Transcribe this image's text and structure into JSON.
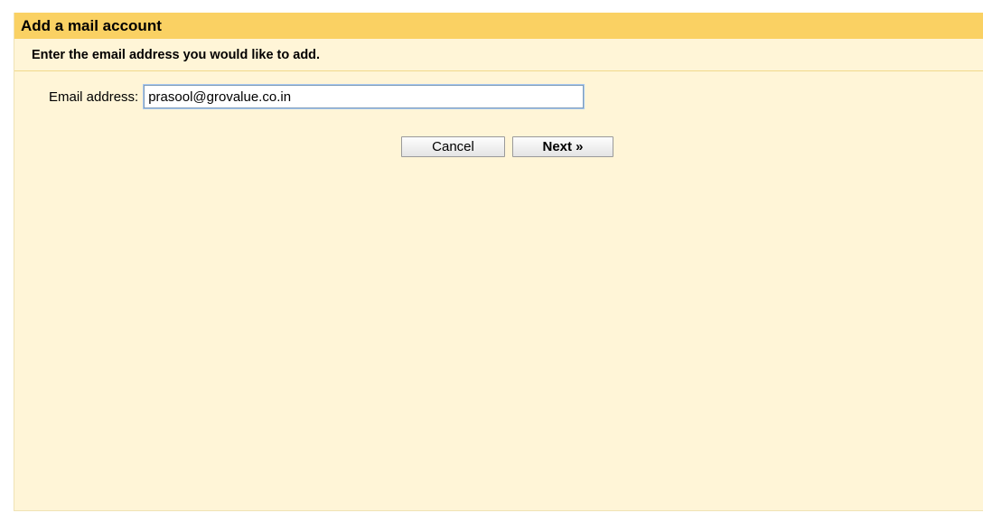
{
  "dialog": {
    "title": "Add a mail account",
    "instruction": "Enter the email address you would like to add.",
    "email_label": "Email address:",
    "email_value": "prasool@grovalue.co.in",
    "cancel_label": "Cancel",
    "next_label": "Next »"
  },
  "colors": {
    "title_bar": "#fad163",
    "panel_background": "#fff5d7",
    "input_border": "#7f9db9"
  }
}
